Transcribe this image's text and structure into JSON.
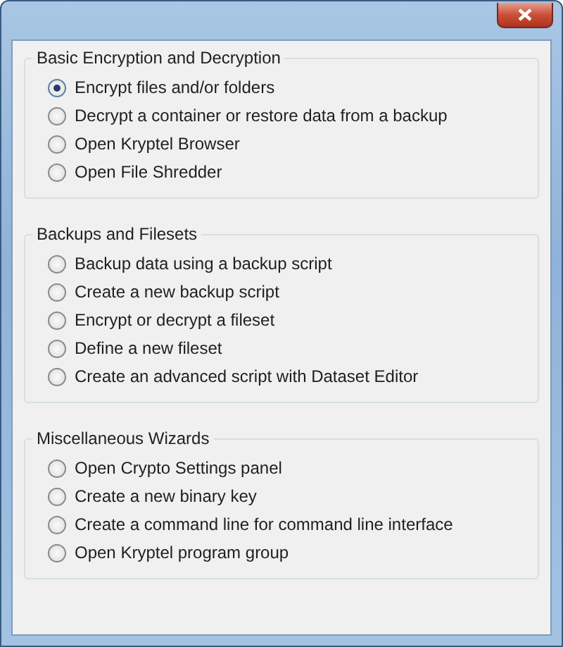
{
  "groups": [
    {
      "title": "Basic Encryption and Decryption",
      "options": [
        {
          "label": "Encrypt files and/or folders",
          "selected": true
        },
        {
          "label": "Decrypt a container or restore data from a backup",
          "selected": false
        },
        {
          "label": "Open Kryptel Browser",
          "selected": false
        },
        {
          "label": "Open File Shredder",
          "selected": false
        }
      ]
    },
    {
      "title": "Backups and Filesets",
      "options": [
        {
          "label": "Backup data using a backup script",
          "selected": false
        },
        {
          "label": "Create a new backup script",
          "selected": false
        },
        {
          "label": "Encrypt or decrypt a fileset",
          "selected": false
        },
        {
          "label": "Define a new fileset",
          "selected": false
        },
        {
          "label": "Create an advanced script with Dataset Editor",
          "selected": false
        }
      ]
    },
    {
      "title": "Miscellaneous Wizards",
      "options": [
        {
          "label": "Open Crypto Settings panel",
          "selected": false
        },
        {
          "label": "Create a new binary key",
          "selected": false
        },
        {
          "label": "Create a command line for command line interface",
          "selected": false
        },
        {
          "label": "Open Kryptel program group",
          "selected": false
        }
      ]
    }
  ]
}
